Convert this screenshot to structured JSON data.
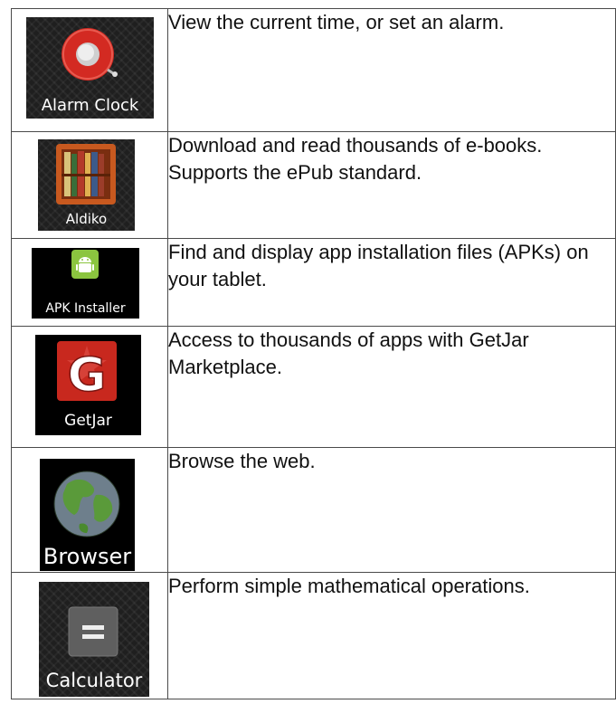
{
  "apps": [
    {
      "label": "Alarm Clock",
      "icon": "alarm-clock-icon",
      "description": "View the current time, or set an alarm."
    },
    {
      "label": "Aldiko",
      "icon": "bookshelf-icon",
      "description": "Download and read thousands of e-books. Supports the ePub standard."
    },
    {
      "label": "APK Installer",
      "icon": "android-robot-icon",
      "description": "Find and display app installation files (APKs) on your tablet."
    },
    {
      "label": "GetJar",
      "icon": "getjar-g-icon",
      "description": "Access to thousands of apps with GetJar Marketplace."
    },
    {
      "label": "Browser",
      "icon": "globe-icon",
      "description": "Browse the web."
    },
    {
      "label": "Calculator",
      "icon": "equals-icon",
      "description": "Perform simple mathematical operations."
    }
  ],
  "colors": {
    "alarm_red": "#d32a22",
    "aldiko_orange": "#c8591f",
    "android_green": "#8bc53f",
    "getjar_red": "#c8281e",
    "globe_green": "#5a9a3a",
    "border": "#4a4a4a"
  }
}
